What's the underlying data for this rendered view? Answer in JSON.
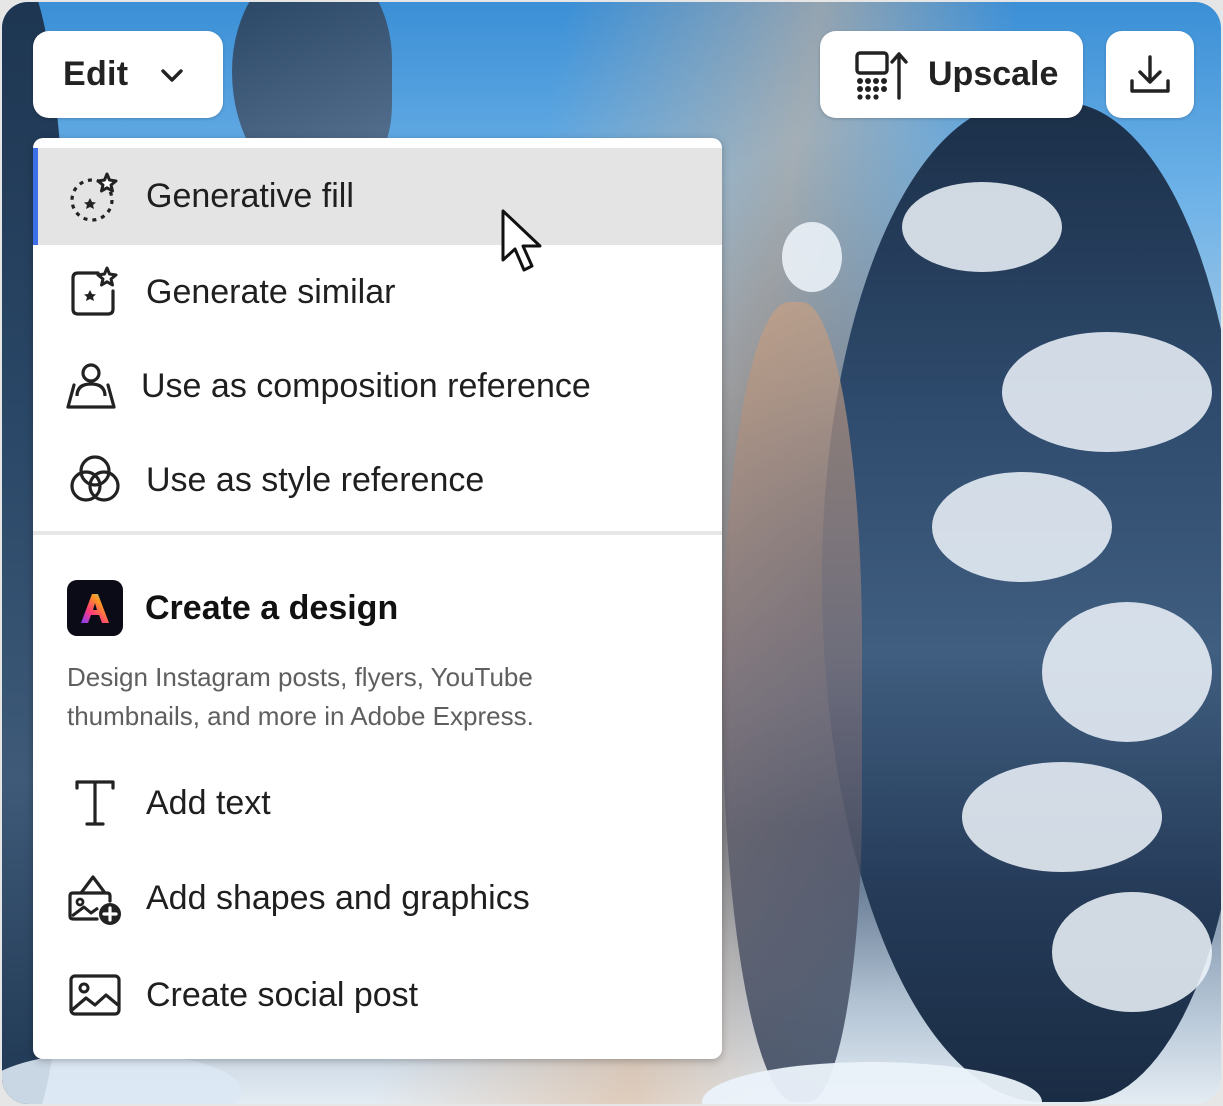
{
  "toolbar": {
    "edit_label": "Edit",
    "upscale_label": "Upscale"
  },
  "menu": {
    "items": [
      {
        "label": "Generative fill",
        "icon": "generative-fill-icon",
        "state": "hover"
      },
      {
        "label": "Generate similar",
        "icon": "generate-similar-icon"
      },
      {
        "label": "Use as composition reference",
        "icon": "composition-reference-icon"
      },
      {
        "label": "Use as style reference",
        "icon": "style-reference-icon"
      }
    ],
    "design_section": {
      "title": "Create a design",
      "description": "Design Instagram posts, flyers, YouTube thumbnails, and more in Adobe Express.",
      "icon": "adobe-express-icon",
      "items": [
        {
          "label": "Add text",
          "icon": "text-icon"
        },
        {
          "label": "Add shapes and graphics",
          "icon": "shapes-graphics-icon"
        },
        {
          "label": "Create social post",
          "icon": "image-icon"
        }
      ]
    }
  },
  "colors": {
    "hover_accent": "#3d6fe8",
    "hover_bg": "#e4e4e4"
  }
}
